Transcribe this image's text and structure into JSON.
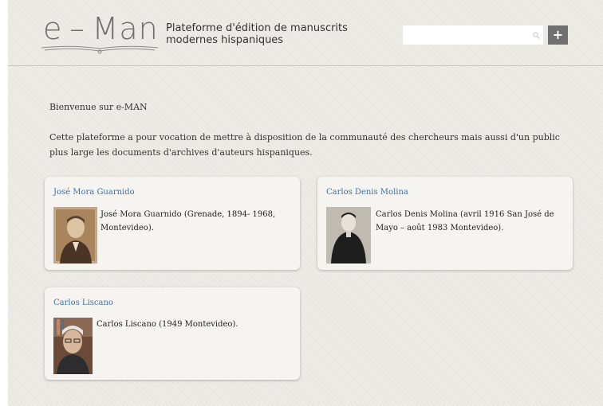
{
  "header": {
    "logo_text": "e – Man",
    "site_title": "Plateforme d'édition de manuscrits modernes hispaniques",
    "search_placeholder": "",
    "add_label": "+"
  },
  "main": {
    "welcome": "Bienvenue sur e-MAN",
    "intro": "Cette plateforme a pour vocation de mettre à disposition de la communauté des chercheurs mais aussi d'un public plus large les documents d'archives d'auteurs hispaniques."
  },
  "authors": [
    {
      "name": "José Mora Guarnido",
      "description": "José Mora Guarnido (Grenade, 1894- 1968, Montevideo)."
    },
    {
      "name": "Carlos Denis Molina",
      "description": "Carlos Denis Molina (avril 1916 San José de Mayo – août 1983 Montevideo)."
    },
    {
      "name": "Carlos Liscano",
      "description": "Carlos Liscano (1949 Montevideo)."
    }
  ],
  "colors": {
    "link": "#3f72a3",
    "add_button": "#707070",
    "background": "#ecebe6"
  },
  "icons": {
    "search": "search-icon",
    "add": "plus-icon"
  }
}
